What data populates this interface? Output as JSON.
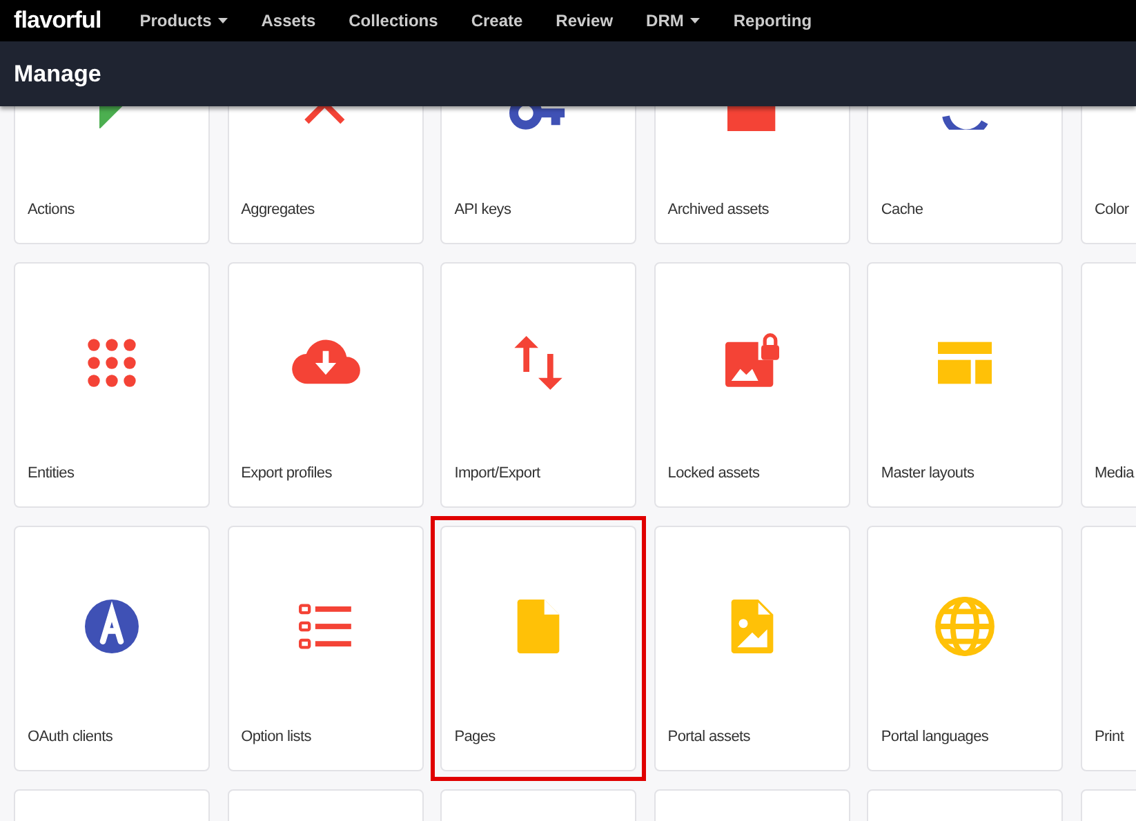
{
  "nav": {
    "logo": "flavorful",
    "items": [
      {
        "label": "Products",
        "has_menu": true
      },
      {
        "label": "Assets",
        "has_menu": false
      },
      {
        "label": "Collections",
        "has_menu": false
      },
      {
        "label": "Create",
        "has_menu": false
      },
      {
        "label": "Review",
        "has_menu": false
      },
      {
        "label": "DRM",
        "has_menu": true
      },
      {
        "label": "Reporting",
        "has_menu": false
      }
    ]
  },
  "header": {
    "title": "Manage"
  },
  "tiles": [
    {
      "label": "Actions",
      "selected": false
    },
    {
      "label": "Aggregates",
      "selected": false
    },
    {
      "label": "API keys",
      "selected": false
    },
    {
      "label": "Archived assets",
      "selected": false
    },
    {
      "label": "Cache",
      "selected": false
    },
    {
      "label": "Color",
      "selected": false
    },
    {
      "label": "Entities",
      "selected": false
    },
    {
      "label": "Export profiles",
      "selected": false
    },
    {
      "label": "Import/Export",
      "selected": false
    },
    {
      "label": "Locked assets",
      "selected": false
    },
    {
      "label": "Master layouts",
      "selected": false
    },
    {
      "label": "Media",
      "selected": false
    },
    {
      "label": "OAuth clients",
      "selected": false
    },
    {
      "label": "Option lists",
      "selected": false
    },
    {
      "label": "Pages",
      "selected": true
    },
    {
      "label": "Portal assets",
      "selected": false
    },
    {
      "label": "Portal languages",
      "selected": false
    },
    {
      "label": "Print",
      "selected": false
    }
  ]
}
